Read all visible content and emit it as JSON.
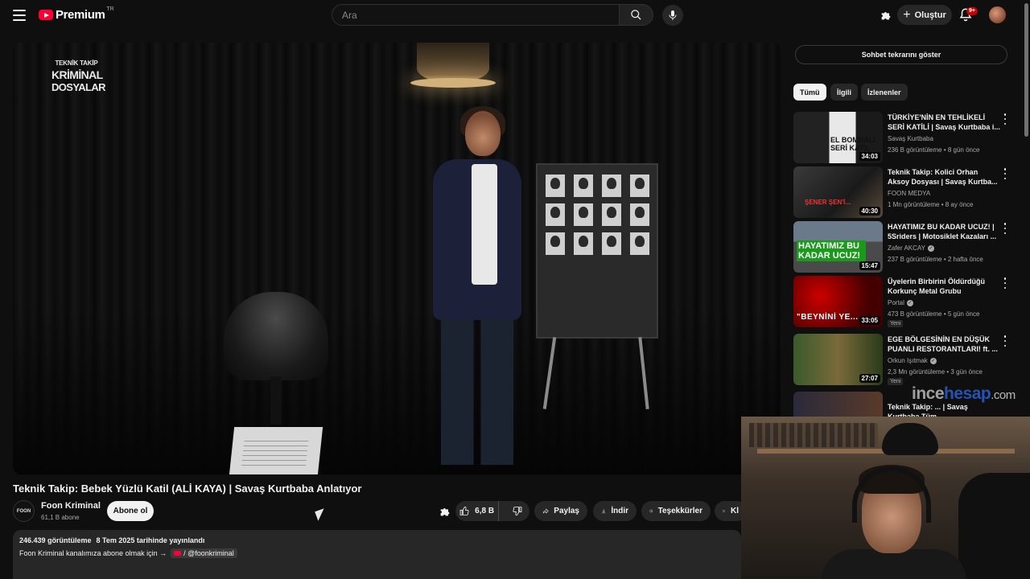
{
  "header": {
    "logo_text": "Premium",
    "logo_country": "TR",
    "search_placeholder": "Ara",
    "create_label": "Oluştur",
    "notification_count": "9+"
  },
  "player": {
    "overlay_logo": {
      "line1": "TEKNİK TAKİP",
      "line2": "KRİMİNAL",
      "line3": "DOSYALAR"
    }
  },
  "video": {
    "title": "Teknik Takip: Bebek Yüzlü Katil (ALİ KAYA) | Savaş Kurtbaba Anlatıyor",
    "channel_name": "Foon Kriminal",
    "channel_avatar_text": "FOON",
    "subscribers": "61,1 B abone",
    "subscribe_label": "Abone ol",
    "like_count": "6,8 B",
    "share_label": "Paylaş",
    "download_label": "İndir",
    "thanks_label": "Teşekkürler",
    "clip_label": "Kl",
    "views": "246.439 görüntüleme",
    "published": "8 Tem 2025 tarihinde yayınlandı",
    "desc_line": "Foon Kriminal kanalımıza abone olmak için →",
    "desc_handle": "/ @foonkriminal"
  },
  "sidebar": {
    "chat_button": "Sohbet tekrarını göster",
    "chips": [
      "Tümü",
      "İlgili",
      "İzlenenler"
    ],
    "recommendations": [
      {
        "title": "TÜRKİYE'NİN EN TEHLİKELİ SERİ KATİLİ | Savaş Kurtbaba i...",
        "channel": "Savaş Kurtbaba",
        "verified": false,
        "meta": "236 B görüntüleme • 8 gün önce",
        "duration": "34:03",
        "thumb_text": "EL BOMBALI SERİ KATİL",
        "badge": ""
      },
      {
        "title": "Teknik Takip: Kolici Orhan Aksoy Dosyası | Savaş Kurtba...",
        "channel": "FOON MEDYA",
        "verified": false,
        "meta": "1 Mn görüntüleme • 8 ay önce",
        "duration": "40:30",
        "thumb_text": "ŞENER ŞEN'İ...",
        "badge": ""
      },
      {
        "title": "HAYATIMIZ BU KADAR UCUZ! | 5Sriders | Motosiklet Kazaları ...",
        "channel": "Zafer AKCAY",
        "verified": true,
        "meta": "237 B görüntüleme • 2 hafta önce",
        "duration": "15:47",
        "thumb_text": "HAYATIMIZ BU KADAR UCUZ!",
        "badge": ""
      },
      {
        "title": "Üyelerin Birbirini Öldürdüğü Korkunç Metal Grubu",
        "channel": "Portal",
        "verified": true,
        "meta": "473 B görüntüleme • 5 gün önce",
        "duration": "33:05",
        "thumb_text": "\"BEYNİNİ YE...",
        "badge": "Yeni"
      },
      {
        "title": "EGE BÖLGESİNİN EN DÜŞÜK PUANLI RESTORANTLARI! ft. ...",
        "channel": "Orkun Işıtmak",
        "verified": true,
        "meta": "2,3 Mn görüntüleme • 3 gün önce",
        "duration": "27:07",
        "thumb_text": "",
        "badge": "Yeni"
      },
      {
        "title": "Teknik Takip: ... | Savaş Kurtbaba Tüm ...",
        "channel": "",
        "verified": false,
        "meta": "",
        "duration": "",
        "thumb_text": "",
        "badge": ""
      }
    ]
  },
  "watermark": {
    "part1": "ince",
    "part2": "hesap",
    "part3": ".com"
  },
  "colors": {
    "background": "#0f0f0f",
    "brand_red": "#ff0033",
    "pill_bg": "#272727"
  }
}
